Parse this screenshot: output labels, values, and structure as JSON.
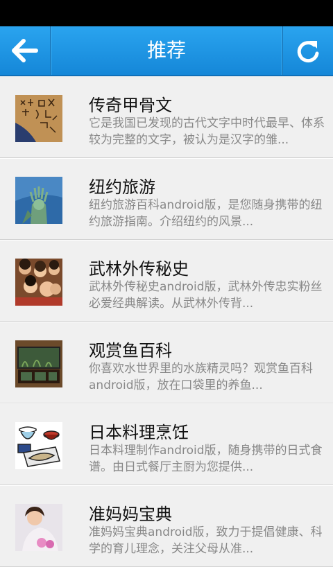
{
  "header": {
    "title": "推荐",
    "back_icon": "arrow-left-icon",
    "refresh_icon": "refresh-icon"
  },
  "items": [
    {
      "title": "传奇甲骨文",
      "desc": "它是我国已发现的古代文字中时代最早、体系较为完整的文字，被认为是汉字的雏..."
    },
    {
      "title": "纽约旅游",
      "desc": "纽约旅游百科android版，是您随身携带的纽约旅游指南。介绍纽约的风景..."
    },
    {
      "title": "武林外传秘史",
      "desc": "武林外传秘史android版，武林外传忠实粉丝必爱经典解读。从武林外传背..."
    },
    {
      "title": "观赏鱼百科",
      "desc": "你喜欢水世界里的水族精灵吗？观赏鱼百科android版，放在口袋里的养鱼..."
    },
    {
      "title": "日本料理烹饪",
      "desc": "日本料理制作android版，随身携带的日式食谱。由日式餐厅主厨为您提供..."
    },
    {
      "title": "准妈妈宝典",
      "desc": "准妈妈宝典android版，致力于提倡健康、科学的育儿理念，关注父母从准..."
    }
  ]
}
